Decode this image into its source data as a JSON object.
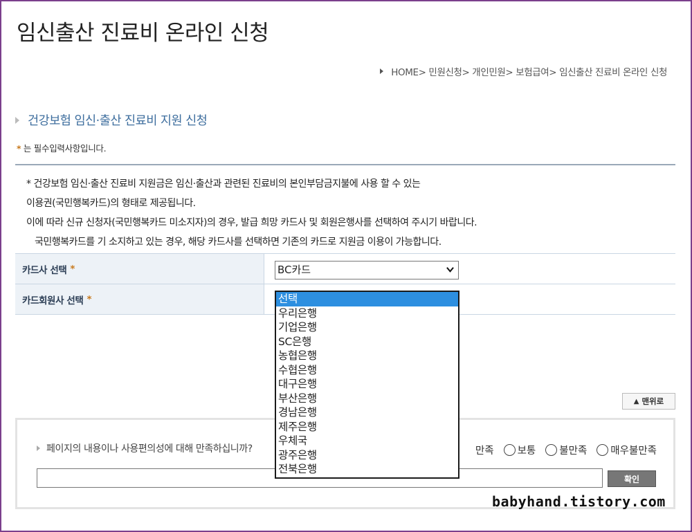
{
  "page": {
    "title": "임신출산 진료비 온라인 신청"
  },
  "breadcrumb": {
    "text": "HOME> 민원신청> 개인민원> 보험급여> 임신출산 진료비 온라인 신청"
  },
  "section": {
    "title": "건강보험 임신·출산 진료비 지원 신청",
    "required_star": "*",
    "required_note": " 는 필수입력사항입니다."
  },
  "info": {
    "lines": [
      "* 건강보험 임신·출산 진료비 지원금은 임신·출산과 관련된 진료비의 본인부담금지불에 사용 할 수 있는",
      "이용권(국민행복카드)의 형태로 제공됩니다.",
      "이에 따라 신규 신청자(국민행복카드 미소지자)의 경우, 발급 희망 카드사 및 회원은행사를 선택하여 주시기 바랍니다.",
      "국민행복카드를 기 소지하고 있는 경우, 해당 카드사를 선택하면 기존의 카드로 지원금 이용이 가능합니다."
    ]
  },
  "form": {
    "card_company_label": "카드사 선택",
    "card_company_value": "BC카드",
    "member_bank_label": "카드회원사 선택",
    "star": "*"
  },
  "dropdown": {
    "options": [
      "선택",
      "우리은행",
      "기업은행",
      "SC은행",
      "농협은행",
      "수협은행",
      "대구은행",
      "부산은행",
      "경남은행",
      "제주은행",
      "우체국",
      "광주은행",
      "전북은행"
    ],
    "selected_index": 0,
    "selected_color": "#2d8fe0"
  },
  "top_button": {
    "label": "맨위로"
  },
  "survey": {
    "question": "페이지의 내용이나 사용편의성에 대해 만족하십니까?",
    "options": [
      "만족",
      "보통",
      "불만족",
      "매우불만족"
    ],
    "input_value": "",
    "confirm_label": "확인"
  },
  "watermark": {
    "text": "babyhand.tistory.com"
  },
  "colors": {
    "frame": "#7b3f8c",
    "section_title": "#3e6e9e",
    "required_star": "#c87a1e"
  }
}
